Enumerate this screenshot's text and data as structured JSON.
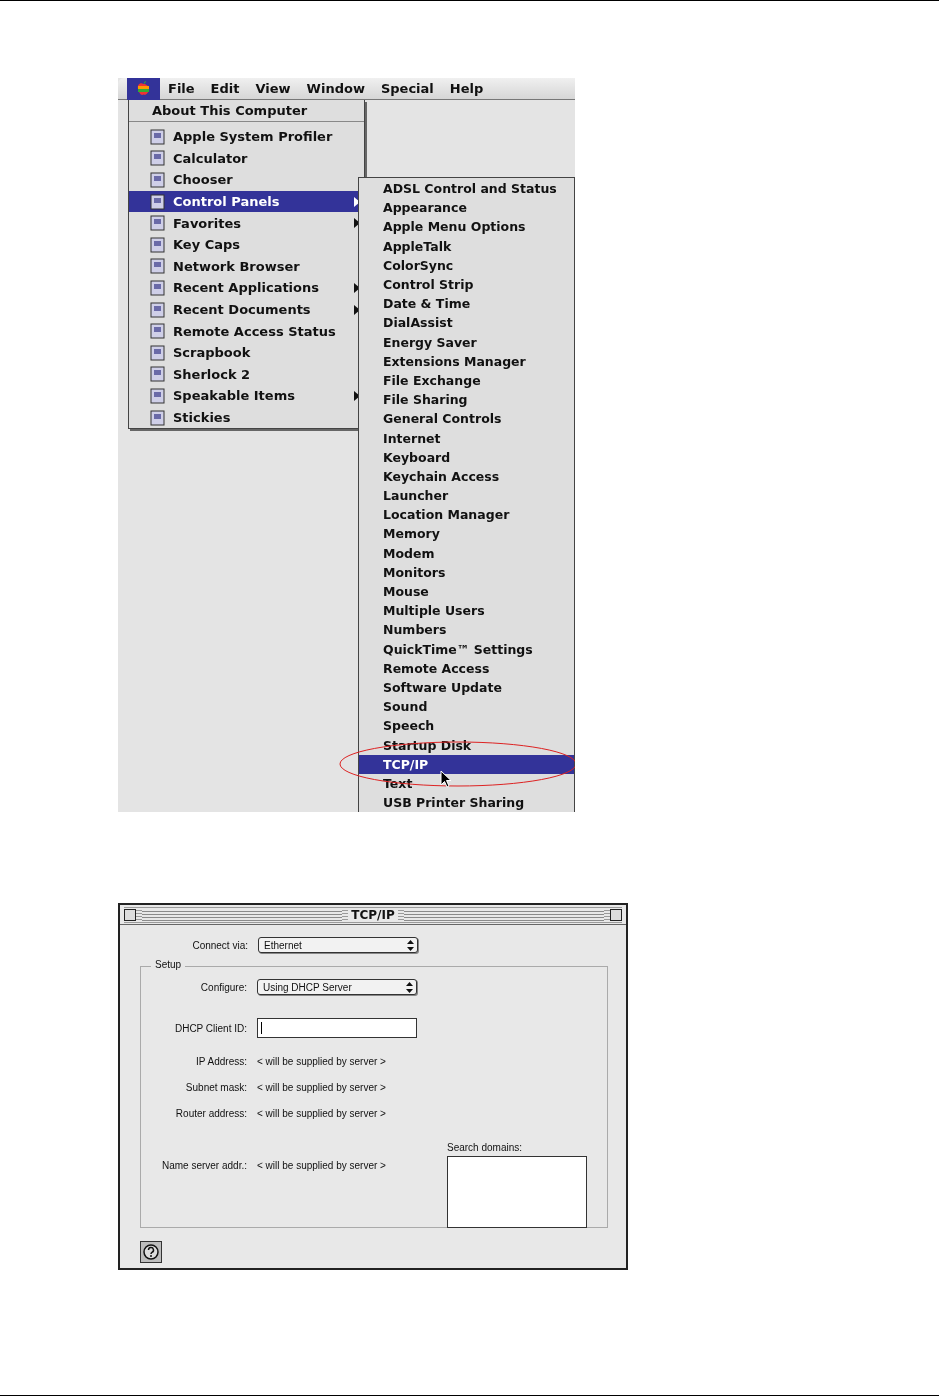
{
  "menubar": {
    "apple_selected": true,
    "items": [
      {
        "label": "File"
      },
      {
        "label": "Edit"
      },
      {
        "label": "View"
      },
      {
        "label": "Window"
      },
      {
        "label": "Special"
      },
      {
        "label": "Help"
      }
    ]
  },
  "apple_menu": {
    "header": "About This Computer",
    "items": [
      {
        "label": "Apple System Profiler",
        "selected": false,
        "has_submenu": false
      },
      {
        "label": "Calculator",
        "selected": false,
        "has_submenu": false
      },
      {
        "label": "Chooser",
        "selected": false,
        "has_submenu": false
      },
      {
        "label": "Control Panels",
        "selected": true,
        "has_submenu": true
      },
      {
        "label": "Favorites",
        "selected": false,
        "has_submenu": true
      },
      {
        "label": "Key Caps",
        "selected": false,
        "has_submenu": false
      },
      {
        "label": "Network Browser",
        "selected": false,
        "has_submenu": false
      },
      {
        "label": "Recent Applications",
        "selected": false,
        "has_submenu": true
      },
      {
        "label": "Recent Documents",
        "selected": false,
        "has_submenu": true
      },
      {
        "label": "Remote Access Status",
        "selected": false,
        "has_submenu": false
      },
      {
        "label": "Scrapbook",
        "selected": false,
        "has_submenu": false
      },
      {
        "label": "Sherlock 2",
        "selected": false,
        "has_submenu": false
      },
      {
        "label": "Speakable Items",
        "selected": false,
        "has_submenu": true
      },
      {
        "label": "Stickies",
        "selected": false,
        "has_submenu": false
      }
    ]
  },
  "control_panels_menu": {
    "items": [
      {
        "label": "ADSL Control and Status",
        "selected": false
      },
      {
        "label": "Appearance",
        "selected": false
      },
      {
        "label": "Apple Menu Options",
        "selected": false
      },
      {
        "label": "AppleTalk",
        "selected": false
      },
      {
        "label": "ColorSync",
        "selected": false
      },
      {
        "label": "Control Strip",
        "selected": false
      },
      {
        "label": "Date & Time",
        "selected": false
      },
      {
        "label": "DialAssist",
        "selected": false
      },
      {
        "label": "Energy Saver",
        "selected": false
      },
      {
        "label": "Extensions Manager",
        "selected": false
      },
      {
        "label": "File Exchange",
        "selected": false
      },
      {
        "label": "File Sharing",
        "selected": false
      },
      {
        "label": "General Controls",
        "selected": false
      },
      {
        "label": "Internet",
        "selected": false
      },
      {
        "label": "Keyboard",
        "selected": false
      },
      {
        "label": "Keychain Access",
        "selected": false
      },
      {
        "label": "Launcher",
        "selected": false
      },
      {
        "label": "Location Manager",
        "selected": false
      },
      {
        "label": "Memory",
        "selected": false
      },
      {
        "label": "Modem",
        "selected": false
      },
      {
        "label": "Monitors",
        "selected": false
      },
      {
        "label": "Mouse",
        "selected": false
      },
      {
        "label": "Multiple Users",
        "selected": false
      },
      {
        "label": "Numbers",
        "selected": false
      },
      {
        "label": "QuickTime™ Settings",
        "selected": false
      },
      {
        "label": "Remote Access",
        "selected": false
      },
      {
        "label": "Software Update",
        "selected": false
      },
      {
        "label": "Sound",
        "selected": false
      },
      {
        "label": "Speech",
        "selected": false
      },
      {
        "label": "Startup Disk",
        "selected": false
      },
      {
        "label": "TCP/IP",
        "selected": true
      },
      {
        "label": "Text",
        "selected": false
      },
      {
        "label": "USB Printer Sharing",
        "selected": false
      }
    ]
  },
  "tcpip_window": {
    "title": "TCP/IP",
    "connect_via": {
      "label": "Connect via:",
      "value": "Ethernet"
    },
    "setup": {
      "title": "Setup",
      "configure": {
        "label": "Configure:",
        "value": "Using DHCP Server"
      },
      "dhcp_client_id": {
        "label": "DHCP Client ID:"
      },
      "fields": [
        {
          "label": "IP Address:",
          "value": "< will be supplied by server >"
        },
        {
          "label": "Subnet mask:",
          "value": "< will be supplied by server >"
        },
        {
          "label": "Router address:",
          "value": "< will be supplied by server >"
        }
      ],
      "name_server": {
        "label": "Name server addr.:",
        "value": "< will be supplied by server >"
      },
      "search_domains": {
        "label": "Search domains:"
      }
    }
  }
}
